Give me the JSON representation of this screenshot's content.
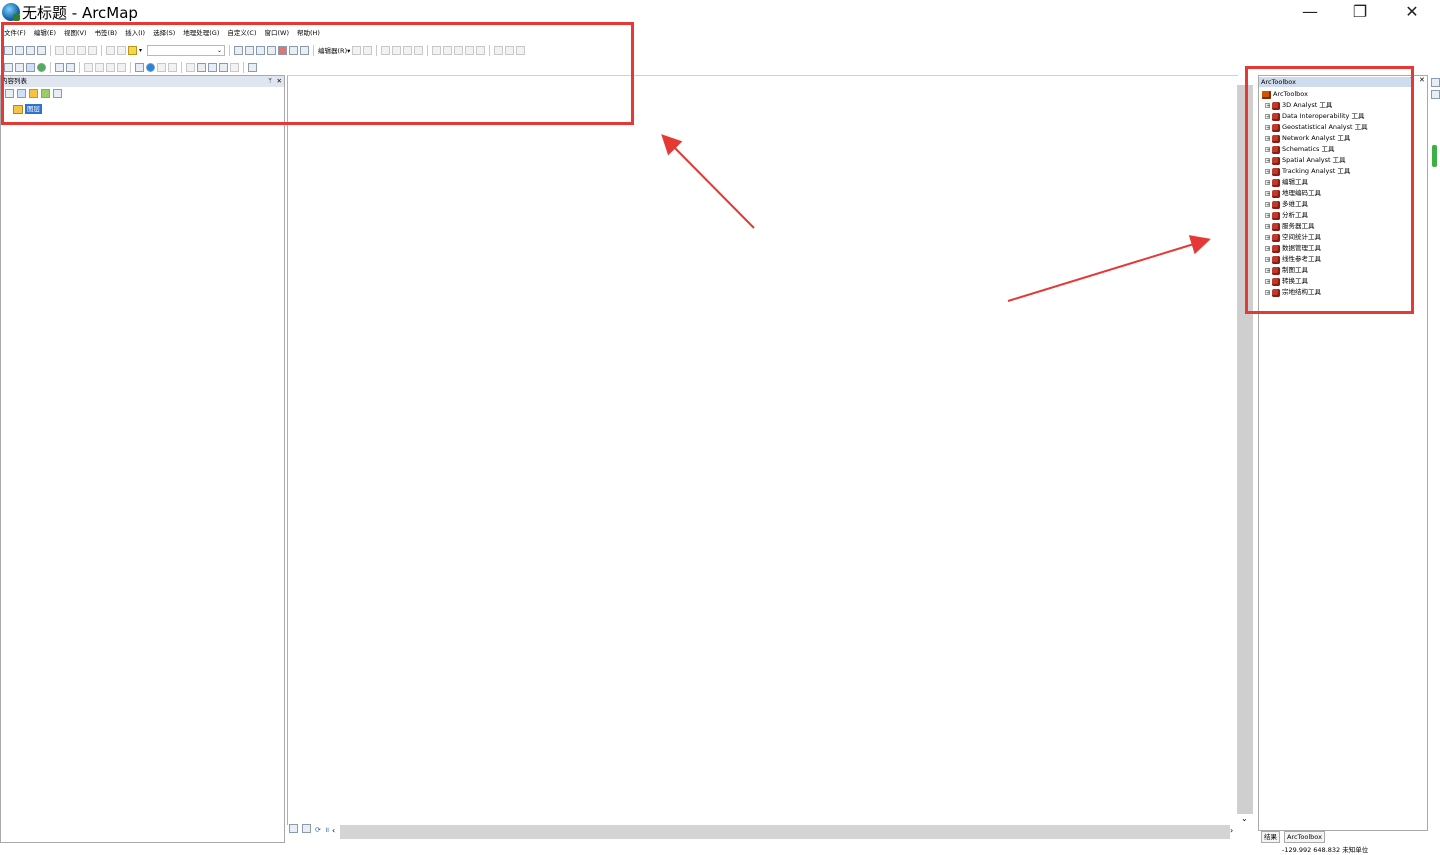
{
  "window": {
    "title": "无标题 - ArcMap"
  },
  "menu": [
    "文件(F)",
    "编辑(E)",
    "视图(V)",
    "书签(B)",
    "插入(I)",
    "选择(S)",
    "地理处理(G)",
    "自定义(C)",
    "窗口(W)",
    "帮助(H)"
  ],
  "toolbar": {
    "editor_label": "编辑器(R)▾"
  },
  "toc": {
    "title": "内容列表",
    "layer": "图层"
  },
  "toolbox": {
    "title": "ArcToolbox",
    "root": "ArcToolbox",
    "items": [
      "3D Analyst 工具",
      "Data Interoperability 工具",
      "Geostatistical Analyst 工具",
      "Network Analyst 工具",
      "Schematics 工具",
      "Spatial Analyst 工具",
      "Tracking Analyst 工具",
      "编辑工具",
      "地理编码工具",
      "多维工具",
      "分析工具",
      "服务器工具",
      "空间统计工具",
      "数据管理工具",
      "线性参考工具",
      "制图工具",
      "转换工具",
      "宗地结构工具"
    ],
    "tabs": [
      "结果",
      "ArcToolbox"
    ]
  },
  "status": {
    "coords": "-129.992  648.832 未知单位"
  },
  "colors": {
    "annotation": "#e53935",
    "selection": "#3072d0"
  }
}
